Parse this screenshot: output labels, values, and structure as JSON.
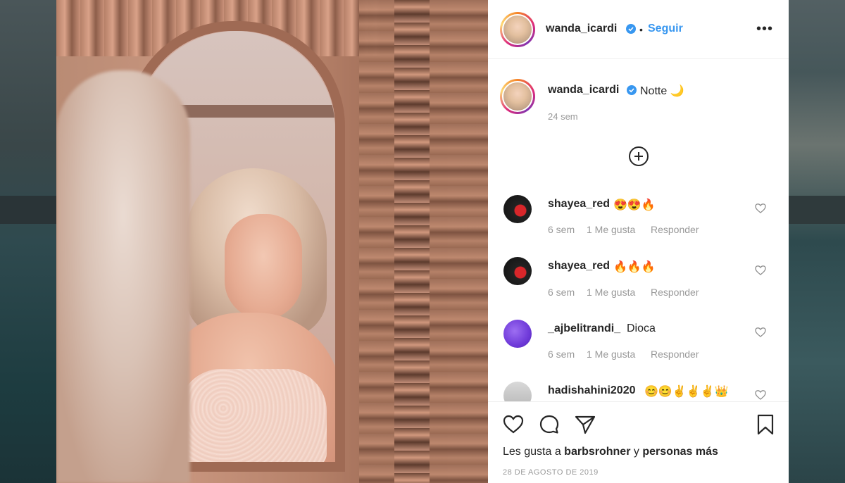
{
  "post": {
    "author": "wanda_icardi",
    "follow_label": "Seguir",
    "dot": "•",
    "more_label": "•••",
    "caption": "Notte 🌙",
    "caption_time": "24 sem",
    "likes_prefix": "Les gusta a ",
    "likes_user": "barbsrohner",
    "likes_mid": " y ",
    "likes_suffix": "personas más",
    "date": "28 DE AGOSTO DE 2019"
  },
  "comments": [
    {
      "user": "shayea_red",
      "text": "😍😍🔥",
      "time": "6 sem",
      "likes": "1 Me gusta",
      "reply": "Responder"
    },
    {
      "user": "shayea_red",
      "text": "🔥🔥🔥",
      "time": "6 sem",
      "likes": "1 Me gusta",
      "reply": "Responder"
    },
    {
      "user": "_ajbelitrandi_",
      "text": "Dioca",
      "time": "6 sem",
      "likes": "1 Me gusta",
      "reply": "Responder"
    },
    {
      "user": "hadishahini2020",
      "text": "😊😊✌✌✌👑",
      "time": "",
      "likes": "",
      "reply": ""
    }
  ],
  "colors": {
    "accent": "#3897f0",
    "text": "#262626",
    "muted": "#999999"
  },
  "icons": [
    "verified-badge-icon",
    "add-comment-icon",
    "heart-icon",
    "comment-icon",
    "share-icon",
    "bookmark-icon"
  ]
}
